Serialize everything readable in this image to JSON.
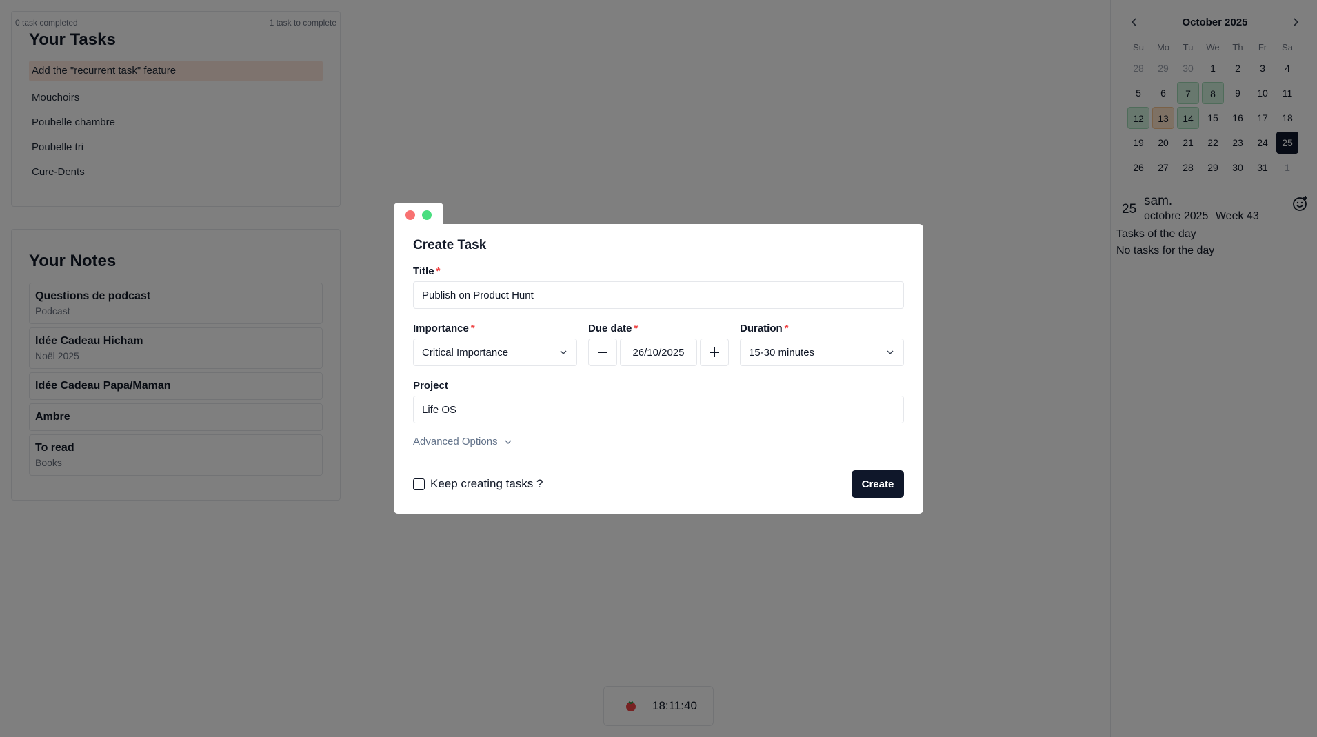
{
  "tasks_card": {
    "completed": "0 task completed",
    "to_complete": "1 task to complete",
    "title": "Your Tasks",
    "items": [
      {
        "label": "Add the \"recurrent task\" feature"
      },
      {
        "label": "Mouchoirs"
      },
      {
        "label": "Poubelle chambre"
      },
      {
        "label": "Poubelle tri"
      },
      {
        "label": "Cure-Dents"
      }
    ]
  },
  "notes_card": {
    "title": "Your Notes",
    "items": [
      {
        "title": "Questions de podcast",
        "sub": "Podcast"
      },
      {
        "title": "Idée Cadeau Hicham",
        "sub": "Noël 2025"
      },
      {
        "title": "Idée Cadeau Papa/Maman",
        "sub": ""
      },
      {
        "title": "Ambre",
        "sub": ""
      },
      {
        "title": "To read",
        "sub": "Books"
      }
    ]
  },
  "calendar": {
    "month": "October 2025",
    "weekdays": [
      "Su",
      "Mo",
      "Tu",
      "We",
      "Th",
      "Fr",
      "Sa"
    ],
    "days": [
      {
        "n": "28",
        "s": "muted"
      },
      {
        "n": "29",
        "s": "muted"
      },
      {
        "n": "30",
        "s": "muted"
      },
      {
        "n": "1",
        "s": ""
      },
      {
        "n": "2",
        "s": ""
      },
      {
        "n": "3",
        "s": ""
      },
      {
        "n": "4",
        "s": ""
      },
      {
        "n": "5",
        "s": ""
      },
      {
        "n": "6",
        "s": ""
      },
      {
        "n": "7",
        "s": "green"
      },
      {
        "n": "8",
        "s": "green"
      },
      {
        "n": "9",
        "s": ""
      },
      {
        "n": "10",
        "s": ""
      },
      {
        "n": "11",
        "s": ""
      },
      {
        "n": "12",
        "s": "green"
      },
      {
        "n": "13",
        "s": "orange"
      },
      {
        "n": "14",
        "s": "green"
      },
      {
        "n": "15",
        "s": ""
      },
      {
        "n": "16",
        "s": ""
      },
      {
        "n": "17",
        "s": ""
      },
      {
        "n": "18",
        "s": ""
      },
      {
        "n": "19",
        "s": ""
      },
      {
        "n": "20",
        "s": ""
      },
      {
        "n": "21",
        "s": ""
      },
      {
        "n": "22",
        "s": ""
      },
      {
        "n": "23",
        "s": ""
      },
      {
        "n": "24",
        "s": ""
      },
      {
        "n": "25",
        "s": "today"
      },
      {
        "n": "26",
        "s": ""
      },
      {
        "n": "27",
        "s": ""
      },
      {
        "n": "28",
        "s": ""
      },
      {
        "n": "29",
        "s": ""
      },
      {
        "n": "30",
        "s": ""
      },
      {
        "n": "31",
        "s": ""
      },
      {
        "n": "1",
        "s": "muted"
      }
    ],
    "selected": {
      "day_num": "25",
      "day_name": "sam.",
      "month_year": "octobre 2025",
      "week": "Week 43"
    },
    "tasks_label": "Tasks of the day",
    "no_tasks": "No tasks for the day"
  },
  "timer": {
    "time": "18:11:40"
  },
  "modal": {
    "title": "Create Task",
    "title_label": "Title",
    "title_value": "Publish on Product Hunt",
    "importance_label": "Importance",
    "importance_value": "Critical Importance",
    "due_label": "Due date",
    "due_value": "26/10/2025",
    "duration_label": "Duration",
    "duration_value": "15-30 minutes",
    "project_label": "Project",
    "project_value": "Life OS",
    "advanced_label": "Advanced Options",
    "keep_label": "Keep creating tasks ?",
    "create_label": "Create",
    "required_mark": "*"
  },
  "colors": {
    "accent": "#0f172a",
    "required": "#ef4444",
    "highlight_task": "#fde7dd"
  }
}
